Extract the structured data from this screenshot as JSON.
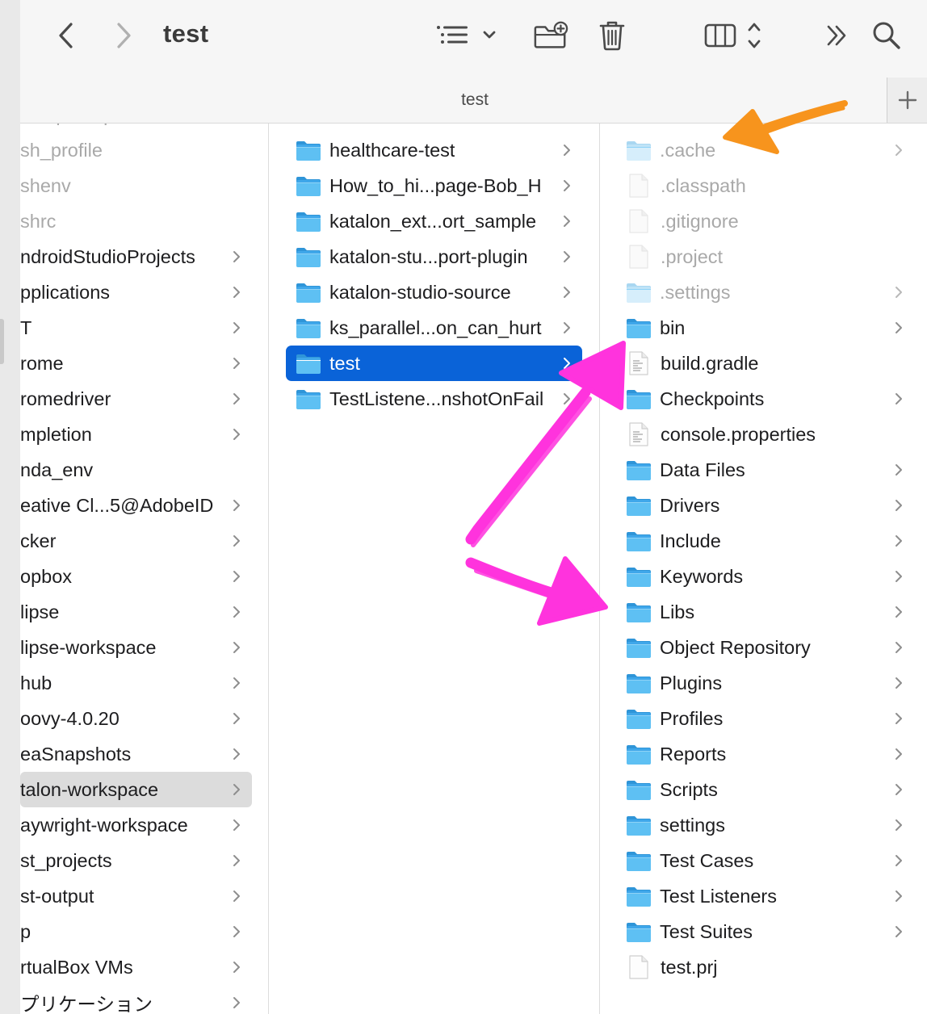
{
  "window": {
    "title": "test",
    "path_title": "test",
    "toolbar": {
      "back": "chevron-left-icon",
      "forward": "chevron-right-icon",
      "view_options": "list-view-icon",
      "new_folder": "new-folder-icon",
      "delete": "trash-icon",
      "columns": "column-view-icon",
      "more": "double-chevron-right-icon",
      "search": "search-icon"
    },
    "new_tab": "+"
  },
  "col1": {
    "items": [
      {
        "label": "compdump",
        "folder": false
      },
      {
        "label": "sh_profile",
        "folder": false
      },
      {
        "label": "shenv",
        "folder": false
      },
      {
        "label": "shrc",
        "folder": false
      },
      {
        "label": "ndroidStudioProjects",
        "folder": true
      },
      {
        "label": "pplications",
        "folder": true
      },
      {
        "label": "T",
        "folder": true
      },
      {
        "label": "rome",
        "folder": true
      },
      {
        "label": "romedriver",
        "folder": true
      },
      {
        "label": "mpletion",
        "folder": true
      },
      {
        "label": "nda_env",
        "folder": false
      },
      {
        "label": "eative Cl...5@AdobeID",
        "folder": true
      },
      {
        "label": "cker",
        "folder": true
      },
      {
        "label": "opbox",
        "folder": true
      },
      {
        "label": "lipse",
        "folder": true
      },
      {
        "label": "lipse-workspace",
        "folder": true
      },
      {
        "label": "hub",
        "folder": true
      },
      {
        "label": "oovy-4.0.20",
        "folder": true
      },
      {
        "label": "eaSnapshots",
        "folder": true
      },
      {
        "label": "talon-workspace",
        "folder": true,
        "selected": true
      },
      {
        "label": "aywright-workspace",
        "folder": true
      },
      {
        "label": "st_projects",
        "folder": true
      },
      {
        "label": "st-output",
        "folder": true
      },
      {
        "label": "p",
        "folder": true
      },
      {
        "label": "rtualBox VMs",
        "folder": true
      },
      {
        "label": "プリケーション",
        "folder": true
      }
    ]
  },
  "col2": {
    "items": [
      {
        "label": "healthcare-test",
        "folder": true
      },
      {
        "label": "How_to_hi...page-Bob_H",
        "folder": true
      },
      {
        "label": "katalon_ext...ort_sample",
        "folder": true
      },
      {
        "label": "katalon-stu...port-plugin",
        "folder": true
      },
      {
        "label": "katalon-studio-source",
        "folder": true
      },
      {
        "label": "ks_parallel...on_can_hurt",
        "folder": true
      },
      {
        "label": "test",
        "folder": true,
        "selected": true
      },
      {
        "label": "TestListene...nshotOnFail",
        "folder": true
      }
    ]
  },
  "col3": {
    "items": [
      {
        "label": ".cache",
        "kind": "folder",
        "hidden": true,
        "chevron": true
      },
      {
        "label": ".classpath",
        "kind": "file",
        "hidden": true
      },
      {
        "label": ".gitignore",
        "kind": "file",
        "hidden": true
      },
      {
        "label": ".project",
        "kind": "file",
        "hidden": true
      },
      {
        "label": ".settings",
        "kind": "folder",
        "hidden": true,
        "chevron": true
      },
      {
        "label": "bin",
        "kind": "folder",
        "chevron": true
      },
      {
        "label": "build.gradle",
        "kind": "text"
      },
      {
        "label": "Checkpoints",
        "kind": "folder",
        "chevron": true
      },
      {
        "label": "console.properties",
        "kind": "text"
      },
      {
        "label": "Data Files",
        "kind": "folder",
        "chevron": true
      },
      {
        "label": "Drivers",
        "kind": "folder",
        "chevron": true
      },
      {
        "label": "Include",
        "kind": "folder",
        "chevron": true
      },
      {
        "label": "Keywords",
        "kind": "folder",
        "chevron": true
      },
      {
        "label": "Libs",
        "kind": "folder",
        "chevron": true
      },
      {
        "label": "Object Repository",
        "kind": "folder",
        "chevron": true
      },
      {
        "label": "Plugins",
        "kind": "folder",
        "chevron": true
      },
      {
        "label": "Profiles",
        "kind": "folder",
        "chevron": true
      },
      {
        "label": "Reports",
        "kind": "folder",
        "chevron": true
      },
      {
        "label": "Scripts",
        "kind": "folder",
        "chevron": true
      },
      {
        "label": "settings",
        "kind": "folder",
        "chevron": true
      },
      {
        "label": "Test Cases",
        "kind": "folder",
        "chevron": true
      },
      {
        "label": "Test Listeners",
        "kind": "folder",
        "chevron": true
      },
      {
        "label": "Test Suites",
        "kind": "folder",
        "chevron": true
      },
      {
        "label": "test.prj",
        "kind": "file"
      }
    ]
  },
  "colors": {
    "accent_selection": "#0a63d8",
    "annotation_orange": "#f7941d",
    "annotation_magenta": "#ff33dd",
    "folder_blue": "#4fb3ef"
  }
}
